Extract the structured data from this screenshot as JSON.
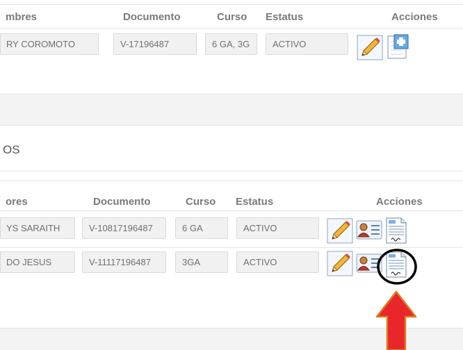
{
  "table1": {
    "headers": {
      "nombres": "mbres",
      "documento": "Documento",
      "curso": "Curso",
      "estatus": "Estatus",
      "acciones": "Acciones"
    },
    "row": {
      "nombres": "RY COROMOTO",
      "documento": "V-17196487",
      "curso": "6 GA, 3G",
      "estatus": "ACTIVO"
    }
  },
  "section2": {
    "title": "OS"
  },
  "table2": {
    "headers": {
      "nombres": "ores",
      "documento": "Documento",
      "curso": "Curso",
      "estatus": "Estatus",
      "acciones": "Acciones"
    },
    "rows": [
      {
        "nombres": "YS SARAITH",
        "documento": "V-10817196487",
        "curso": "6 GA",
        "estatus": "ACTIVO"
      },
      {
        "nombres": "DO JESUS",
        "documento": "V-11117196487",
        "curso": "3GA",
        "estatus": "ACTIVO"
      }
    ]
  },
  "icons": {
    "edit": "pencil-edit-icon",
    "add": "document-add-icon",
    "user_card": "user-card-icon",
    "signed_document": "signed-document-icon"
  },
  "colors": {
    "highlight_circle": "#000000",
    "arrow_fill": "#e8262b",
    "arrow_stroke": "#e07a1e",
    "band": "#f3f3f3"
  }
}
